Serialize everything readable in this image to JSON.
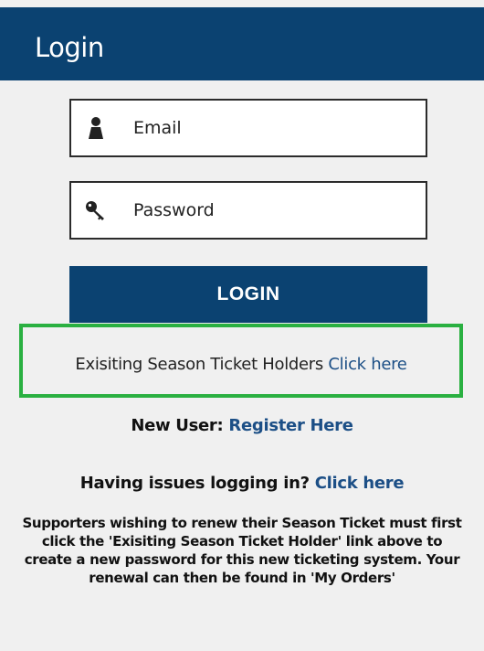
{
  "header": {
    "title": "Login"
  },
  "form": {
    "email": {
      "placeholder": "Email",
      "icon": "user-icon"
    },
    "password": {
      "placeholder": "Password",
      "icon": "key-icon"
    },
    "login_label": "LOGIN"
  },
  "season_ticket": {
    "text": "Exisiting Season Ticket Holders",
    "link": "Click here"
  },
  "new_user": {
    "label": "New User:",
    "link": "Register Here"
  },
  "issues": {
    "label": "Having issues logging in?",
    "link": "Click here"
  },
  "info": {
    "lines": [
      "Supporters wishing to renew their Season Ticket must first",
      "click the 'Exisiting Season Ticket Holder' link above to",
      "create a new password for this new ticketing system. Your",
      "renewal can then be found in 'My Orders'"
    ]
  },
  "colors": {
    "brand": "#0b4271",
    "highlight_border": "#2ab041",
    "link": "#1c4f86",
    "background": "#f0f0f0"
  }
}
